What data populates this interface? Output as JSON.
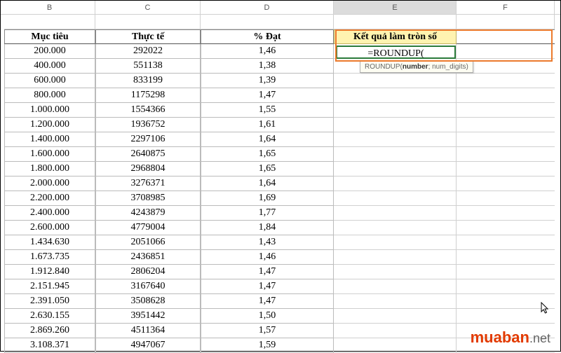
{
  "columns": {
    "B": "B",
    "C": "C",
    "D": "D",
    "E": "E",
    "F": "F"
  },
  "headers": {
    "B": "Mục tiêu",
    "C": "Thực tế",
    "D": "% Đạt",
    "E": "Kết quả làm tròn số"
  },
  "formula": "=ROUNDUP(",
  "tooltip_fn": "ROUNDUP(",
  "tooltip_arg1": "number",
  "tooltip_rest": "; num_digits)",
  "rows": [
    {
      "B": "200.000",
      "C": "292022",
      "D": "1,46"
    },
    {
      "B": "400.000",
      "C": "551138",
      "D": "1,38"
    },
    {
      "B": "600.000",
      "C": "833199",
      "D": "1,39"
    },
    {
      "B": "800.000",
      "C": "1175298",
      "D": "1,47"
    },
    {
      "B": "1.000.000",
      "C": "1554366",
      "D": "1,55"
    },
    {
      "B": "1.200.000",
      "C": "1936752",
      "D": "1,61"
    },
    {
      "B": "1.400.000",
      "C": "2297106",
      "D": "1,64"
    },
    {
      "B": "1.600.000",
      "C": "2640875",
      "D": "1,65"
    },
    {
      "B": "1.800.000",
      "C": "2968804",
      "D": "1,65"
    },
    {
      "B": "2.000.000",
      "C": "3276371",
      "D": "1,64"
    },
    {
      "B": "2.200.000",
      "C": "3708985",
      "D": "1,69"
    },
    {
      "B": "2.400.000",
      "C": "4243879",
      "D": "1,77"
    },
    {
      "B": "2.600.000",
      "C": "4779004",
      "D": "1,84"
    },
    {
      "B": "1.434.630",
      "C": "2051066",
      "D": "1,43"
    },
    {
      "B": "1.673.735",
      "C": "2436851",
      "D": "1,46"
    },
    {
      "B": "1.912.840",
      "C": "2806204",
      "D": "1,47"
    },
    {
      "B": "2.151.945",
      "C": "3167640",
      "D": "1,47"
    },
    {
      "B": "2.391.050",
      "C": "3508628",
      "D": "1,47"
    },
    {
      "B": "2.630.155",
      "C": "3951442",
      "D": "1,50"
    },
    {
      "B": "2.869.260",
      "C": "4511364",
      "D": "1,57"
    },
    {
      "B": "3.108.371",
      "C": "4947067",
      "D": "1,59"
    }
  ],
  "watermark": {
    "p1": "muaban",
    "p2": ".net"
  }
}
